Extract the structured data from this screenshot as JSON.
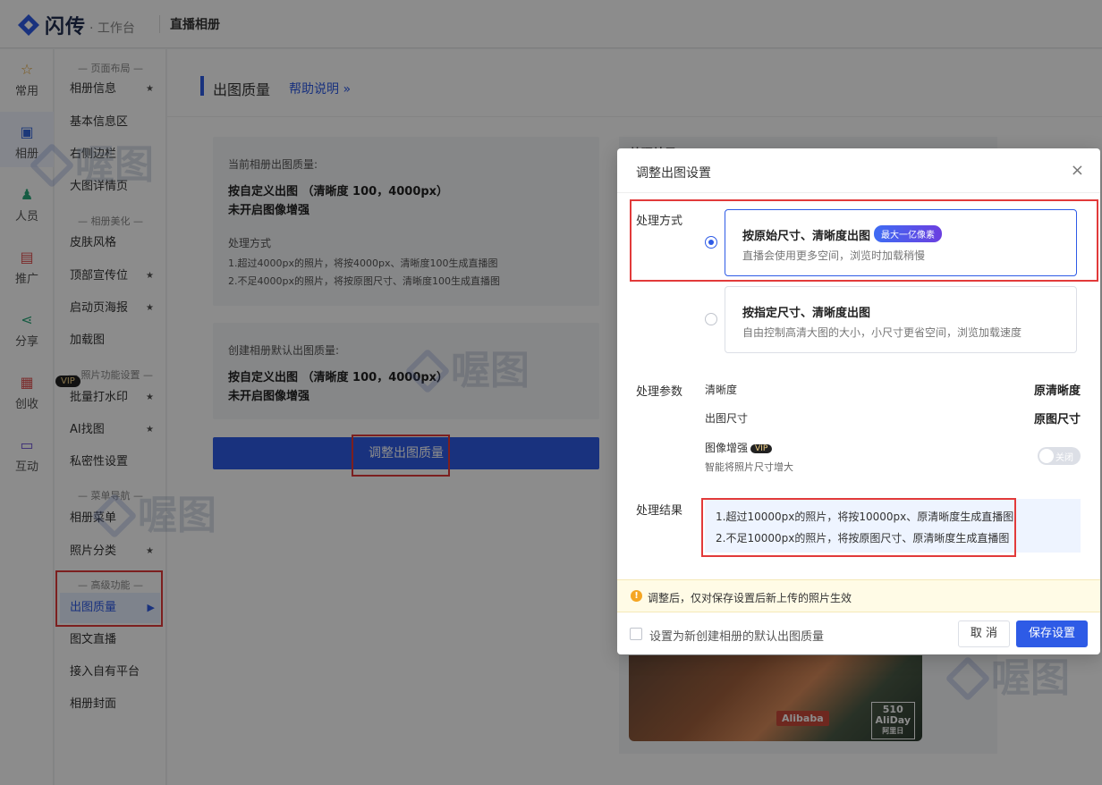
{
  "app": {
    "brand": "闪传",
    "brand_sub": "· 工作台",
    "section_title": "直播相册"
  },
  "rail": [
    {
      "icon": "star-icon",
      "label": "常用"
    },
    {
      "icon": "album-icon",
      "label": "相册"
    },
    {
      "icon": "people-ai-icon",
      "label": "人员"
    },
    {
      "icon": "promote-icon",
      "label": "推广"
    },
    {
      "icon": "share-icon",
      "label": "分享"
    },
    {
      "icon": "create-income-icon",
      "label": "创收"
    },
    {
      "icon": "interact-icon",
      "label": "互动"
    }
  ],
  "rail_vip": "VIP",
  "subnav": {
    "sections": [
      "— 页面布局 —",
      "— 相册美化 —",
      "— 照片功能设置 —",
      "— 菜单导航 —",
      "— 高级功能 —"
    ],
    "items": [
      {
        "label": "相册信息",
        "star": "★"
      },
      {
        "label": "基本信息区",
        "star": ""
      },
      {
        "label": "右侧边栏",
        "star": ""
      },
      {
        "label": "大图详情页",
        "star": ""
      },
      {
        "label": "皮肤风格",
        "star": ""
      },
      {
        "label": "顶部宣传位",
        "star": "★"
      },
      {
        "label": "启动页海报",
        "star": "★"
      },
      {
        "label": "加载图",
        "star": ""
      },
      {
        "label": "批量打水印",
        "star": "★"
      },
      {
        "label": "AI找图",
        "star": "★"
      },
      {
        "label": "私密性设置",
        "star": ""
      },
      {
        "label": "相册菜单",
        "star": ""
      },
      {
        "label": "照片分类",
        "star": "★"
      },
      {
        "label": "出图质量",
        "star": "▶"
      },
      {
        "label": "图文直播",
        "star": ""
      },
      {
        "label": "接入自有平台",
        "star": ""
      },
      {
        "label": "相册封面",
        "star": ""
      }
    ]
  },
  "page": {
    "title": "出图质量",
    "help": "帮助说明 »",
    "current_card": {
      "label": "当前相册出图质量:",
      "line1": "按自定义出图 （清晰度 100，4000px）",
      "line2": "未开启图像增强",
      "method_label": "处理方式",
      "rule1": "1.超过4000px的照片，将按4000px、清晰度100生成直播图",
      "rule2": "2.不足4000px的照片，将按原图尺寸、清晰度100生成直播图"
    },
    "default_card": {
      "label": "创建相册默认出图质量:",
      "line1": "按自定义出图 （清晰度 100，4000px）",
      "line2": "未开启图像增强"
    },
    "adjust_button": "调整出图质量",
    "right_title": "处理结果",
    "preview_brand": "Alibaba",
    "preview_badge1": "510",
    "preview_badge2": "AliDay",
    "preview_badge3": "阿里日"
  },
  "modal": {
    "title": "调整出图设置",
    "close": "×",
    "method_label": "处理方式",
    "option1": {
      "title": "按原始尺寸、清晰度出图",
      "tag": "最大一亿像素",
      "desc": "直播会使用更多空间，浏览时加载稍慢",
      "selected": true
    },
    "option2": {
      "title": "按指定尺寸、清晰度出图",
      "desc": "自由控制高清大图的大小，小尺寸更省空间，浏览加载速度",
      "selected": false
    },
    "params_label": "处理参数",
    "params": [
      {
        "name": "清晰度",
        "value": "原清晰度"
      },
      {
        "name": "出图尺寸",
        "value": "原图尺寸"
      }
    ],
    "enhance_label": "图像增强",
    "enhance_vip": "VIP",
    "enhance_desc": "智能将照片尺寸增大",
    "enhance_toggle": "关闭",
    "result_label": "处理结果",
    "result1": "1.超过10000px的照片，将按10000px、原清晰度生成直播图",
    "result2": "2.不足10000px的照片，将按原图尺寸、原清晰度生成直播图",
    "notice_icon": "!",
    "notice": "调整后，仅对保存设置后新上传的照片生效",
    "default_checkbox": "设置为新创建相册的默认出图质量",
    "cancel": "取 消",
    "save": "保存设置"
  },
  "watermark": "喔图",
  "colors": {
    "accent": "#2e5be6",
    "highlight": "#e23a3a",
    "vip_bg": "#222222",
    "notice_bg": "#fffbe6"
  }
}
